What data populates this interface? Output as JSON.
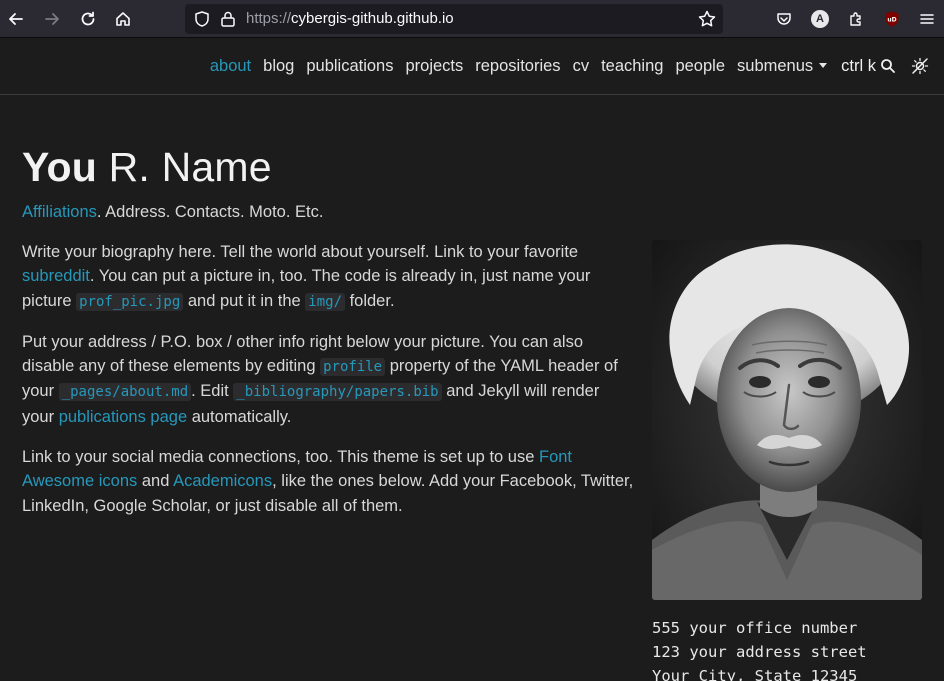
{
  "browser": {
    "url_scheme": "https://",
    "url_host": "cybergis-github.github.io",
    "account_initial": "A"
  },
  "nav": {
    "items": [
      {
        "label": "about",
        "active": true
      },
      {
        "label": "blog"
      },
      {
        "label": "publications"
      },
      {
        "label": "projects"
      },
      {
        "label": "repositories"
      },
      {
        "label": "cv"
      },
      {
        "label": "teaching"
      },
      {
        "label": "people"
      },
      {
        "label": "submenus"
      }
    ],
    "search_label": "ctrl k"
  },
  "page": {
    "title_first": "You",
    "title_rest": " R. Name",
    "subtitle_link": "Affiliations",
    "subtitle_rest": ". Address. Contacts. Moto. Etc.",
    "bio": {
      "p1_a": "Write your biography here. Tell the world about yourself. Link to your favorite ",
      "p1_link": "subreddit",
      "p1_b": ". You can put a picture in, too. The code is already in, just name your picture ",
      "p1_code1": "prof_pic.jpg",
      "p1_c": " and put it in the ",
      "p1_code2": "img/",
      "p1_d": " folder.",
      "p2_a": "Put your address / P.O. box / other info right below your picture. You can also disable any of these elements by editing ",
      "p2_code1": "profile",
      "p2_b": " property of the YAML header of your ",
      "p2_code2": "_pages/about.md",
      "p2_c": ". Edit ",
      "p2_code3": "_bibliography/papers.bib",
      "p2_d": " and Jekyll will render your ",
      "p2_link": "publications page",
      "p2_e": " automatically.",
      "p3_a": "Link to your social media connections, too. This theme is set up to use ",
      "p3_link1": "Font Awesome icons",
      "p3_b": " and ",
      "p3_link2": "Academicons",
      "p3_c": ", like the ones below. Add your Facebook, Twitter, LinkedIn, Google Scholar, or just disable all of them."
    },
    "address": {
      "line1": "555 your office number",
      "line2": "123 your address street",
      "line3": "Your City, State 12345"
    }
  },
  "colors": {
    "accent": "#2698ba",
    "background": "#1c1c1d"
  }
}
